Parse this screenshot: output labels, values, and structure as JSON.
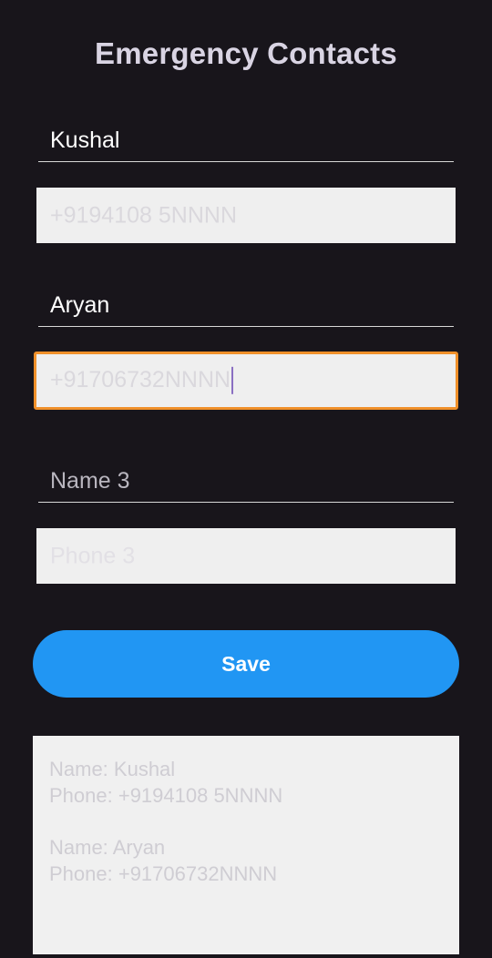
{
  "title": "Emergency Contacts",
  "contacts": [
    {
      "name_value": "Kushal",
      "name_placeholder": "",
      "phone_value": "+9194108 5NNNN",
      "phone_placeholder": ""
    },
    {
      "name_value": "Aryan",
      "name_placeholder": "",
      "phone_value": "+91706732NNNN",
      "phone_placeholder": ""
    },
    {
      "name_value": "",
      "name_placeholder": "Name 3",
      "phone_value": "",
      "phone_placeholder": "Phone 3"
    }
  ],
  "save_label": "Save",
  "summary": [
    {
      "name_line": "Name: Kushal",
      "phone_line": "Phone: +9194108 5NNNN"
    },
    {
      "name_line": "Name: Aryan",
      "phone_line": "Phone: +91706732NNNN"
    }
  ],
  "colors": {
    "background": "#18151b",
    "button": "#2196f3",
    "focus_border": "#f0902a"
  }
}
